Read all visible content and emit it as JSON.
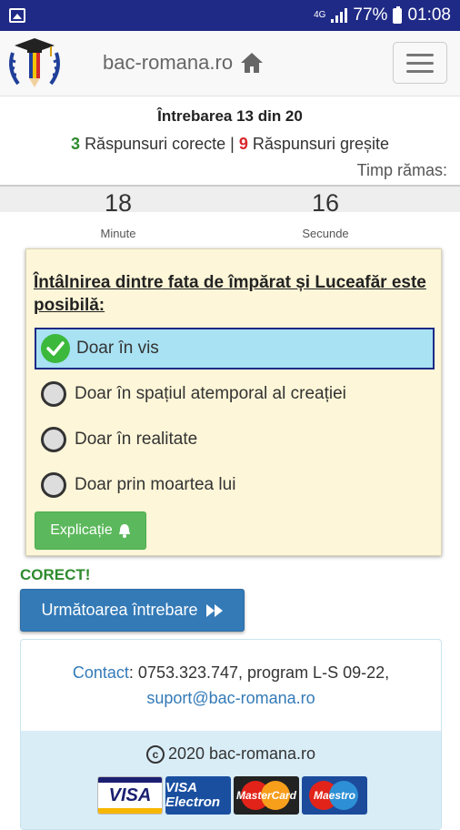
{
  "status_bar": {
    "network": "4G",
    "battery": "77%",
    "time": "01:08"
  },
  "navbar": {
    "brand": "bac-romana.ro"
  },
  "quiz": {
    "question_counter": "Întrebarea 13 din 20",
    "correct_count": "3",
    "correct_label": "Răspunsuri corecte",
    "separator": "|",
    "wrong_count": "9",
    "wrong_label": "Răspunsuri greșite",
    "time_left_label": "Timp rămas:",
    "timer": {
      "minutes": "18",
      "minutes_label": "Minute",
      "seconds": "16",
      "seconds_label": "Secunde"
    },
    "question": "Întâlnirea dintre fata de împărat și Luceafăr este posibilă:",
    "options": [
      {
        "text": "Doar în vis",
        "state": "selected-correct"
      },
      {
        "text": "Doar în spațiul atemporal al creației",
        "state": "unselected"
      },
      {
        "text": "Doar în realitate",
        "state": "unselected"
      },
      {
        "text": "Doar prin moartea lui",
        "state": "unselected"
      }
    ],
    "explain_button": "Explicație",
    "result": "CORECT!",
    "next_button": "Următoarea întrebare"
  },
  "footer": {
    "contact_link": "Contact",
    "contact_text": ": 0753.323.747, program L-S 09-22,",
    "email": "suport@bac-romana.ro",
    "copyright": "2020 bac-romana.ro",
    "payment_cards": [
      "VISA",
      "VISA Electron",
      "MasterCard",
      "Maestro"
    ]
  },
  "colors": {
    "status_bar": "#1f2a86",
    "correct": "#2e8b2e",
    "wrong": "#d9262c",
    "primary": "#337ab7",
    "success": "#5cb85c",
    "question_bg": "#fdf6d8",
    "selected_bg": "#a9e2f3"
  }
}
